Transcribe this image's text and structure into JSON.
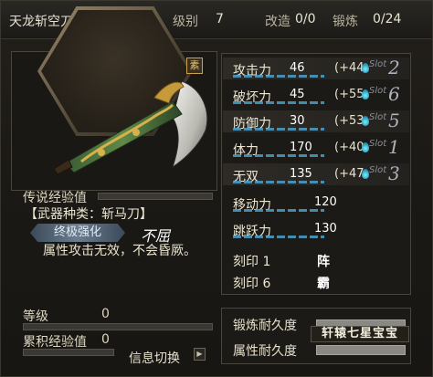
{
  "header": {
    "weapon_name": "天龙斩空刀",
    "level_label": "级别",
    "level_value": "7",
    "modify_label": "改造",
    "modify_value": "0/0",
    "forge_label": "锻炼",
    "forge_value": "0/24"
  },
  "weapon": {
    "badge": "素",
    "legend_exp_label": "传说经验值",
    "type_text": "【武器种类：斩马刀】",
    "ultimate_button": "终极强化",
    "ultimate_name": "不屈",
    "ultimate_desc": "属性攻击无效，不会昏厥。",
    "level_label": "等级",
    "level_value": "0",
    "accum_exp_label": "累积经验值",
    "accum_exp_value": "0",
    "switch_label": "信息切换"
  },
  "stats": [
    {
      "name": "攻击力",
      "value": "46",
      "bonus": "(+44",
      "slot_label": "Slot",
      "slot_num": "2"
    },
    {
      "name": "破坏力",
      "value": "45",
      "bonus": "(+55",
      "slot_label": "Slot",
      "slot_num": "6"
    },
    {
      "name": "防御力",
      "value": "30",
      "bonus": "(+53",
      "slot_label": "Slot",
      "slot_num": "5"
    },
    {
      "name": "体力",
      "value": "170",
      "bonus": "(+40",
      "slot_label": "Slot",
      "slot_num": "1"
    },
    {
      "name": "无双",
      "value": "135",
      "bonus": "(+47",
      "slot_label": "Slot",
      "slot_num": "3"
    }
  ],
  "move": {
    "label": "移动力",
    "value": "120"
  },
  "jump": {
    "label": "跳跃力",
    "value": "130"
  },
  "seals": [
    {
      "label": "刻印 1",
      "value": "阵"
    },
    {
      "label": "刻印 6",
      "value": "霸"
    }
  ],
  "durability": {
    "forge_label": "锻炼耐久度",
    "attr_label": "属性耐久度",
    "engraved_text": "轩辕七星宝宝"
  },
  "colors": {
    "accent_blue": "#4aa8d8",
    "gold": "#c9a24a"
  }
}
